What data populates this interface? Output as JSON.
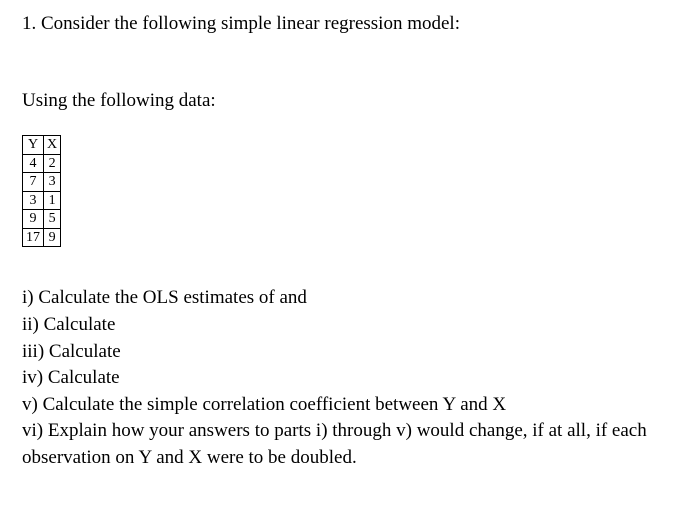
{
  "title": "1. Consider the following simple linear regression model:",
  "data_intro": "Using the following data:",
  "table": {
    "headers": [
      "Y",
      "X"
    ],
    "rows": [
      [
        "4",
        "2"
      ],
      [
        "7",
        "3"
      ],
      [
        "3",
        "1"
      ],
      [
        "9",
        "5"
      ],
      [
        "17",
        "9"
      ]
    ]
  },
  "questions": {
    "i": "i) Calculate the OLS estimates of and",
    "ii": "ii) Calculate",
    "iii": "iii) Calculate",
    "iv": "iv) Calculate",
    "v": "v) Calculate the simple correlation coefficient between Y and X",
    "vi": "vi) Explain how your answers to parts i) through v) would change, if at all, if each observation on Y and X were to be doubled."
  }
}
